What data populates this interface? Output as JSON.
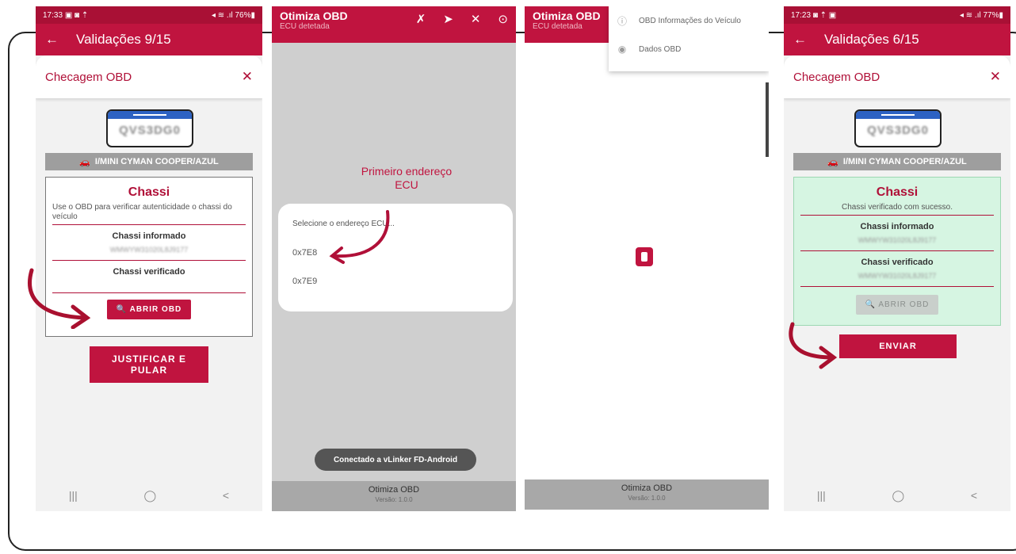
{
  "screen1": {
    "status": {
      "time": "17:33",
      "icons_left": "▣ ◙ ⇡",
      "right": "◂ ≋ .ıl 76%▮"
    },
    "appbar": {
      "back_icon": "←",
      "title": "Validações 9/15"
    },
    "sheet": {
      "title": "Checagem OBD",
      "close_icon": "✕"
    },
    "plate": "QVS3DG0",
    "vehicle": "I/MINI CYMAN COOPER/AZUL",
    "card": {
      "title": "Chassi",
      "description": "Use o OBD para verificar autenticidade o chassi do veículo",
      "informed_label": "Chassi informado",
      "informed_value": "WMWYW31020L8J9177",
      "verified_label": "Chassi verificado",
      "open_button": "ABRIR OBD"
    },
    "skip_button": "JUSTIFICAR E PULAR",
    "nav": [
      "|||",
      "◯",
      "<"
    ]
  },
  "screen2": {
    "app_title": "Otimiza OBD",
    "app_subtitle": "ECU detetada",
    "annotation": "Primeiro endereço ECU",
    "dialog": {
      "title": "Selecione o endereço ECU...",
      "options": [
        "0x7E8",
        "0x7E9"
      ]
    },
    "toast": "Conectado a vLinker FD-Android",
    "footer_title": "Otimiza OBD",
    "footer_version": "Versão: 1.0.0"
  },
  "screen3": {
    "app_title": "Otimiza OBD",
    "app_subtitle": "ECU detetada",
    "menu": [
      {
        "icon": "info-icon",
        "label": "OBD Informações do Veículo"
      },
      {
        "icon": "eye-icon",
        "label": "Dados OBD"
      }
    ],
    "footer_title": "Otimiza OBD",
    "footer_version": "Versão: 1.0.0"
  },
  "screen4": {
    "status": {
      "time": "17:23",
      "icons_left": "◙ ⇡ ▣",
      "right": "◂ ≋ .ıl 77%▮"
    },
    "appbar": {
      "back_icon": "←",
      "title": "Validações 6/15"
    },
    "sheet": {
      "title": "Checagem OBD",
      "close_icon": "✕"
    },
    "plate": "QVS3DG0",
    "vehicle": "I/MINI CYMAN COOPER/AZUL",
    "card": {
      "title": "Chassi",
      "description": "Chassi verificado com sucesso.",
      "informed_label": "Chassi informado",
      "informed_value": "WMWYW31020L8J9177",
      "verified_label": "Chassi verificado",
      "verified_value": "WMWYW31020L8J9177",
      "open_button": "ABRIR OBD"
    },
    "send_button": "ENVIAR",
    "nav": [
      "|||",
      "◯",
      "<"
    ]
  },
  "colors": {
    "brand": "#c0143f",
    "status_bar": "#a91035",
    "success_bg": "#d6f5e2"
  }
}
